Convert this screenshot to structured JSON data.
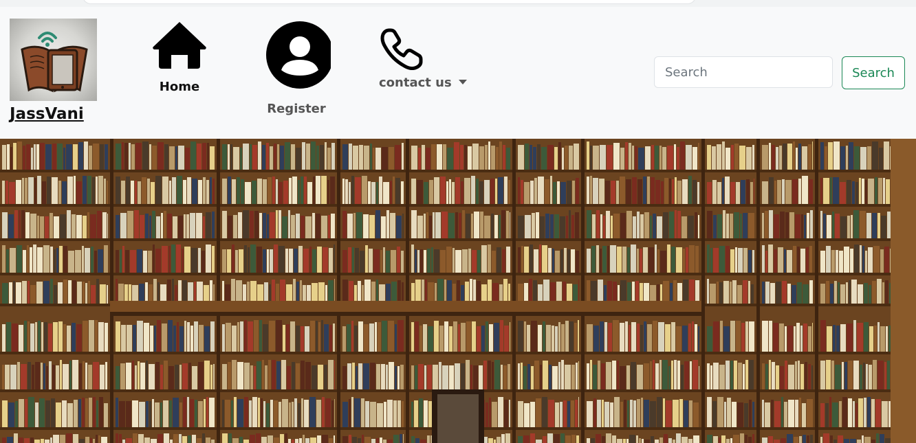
{
  "navbar": {
    "brand": {
      "name": "JassVani",
      "logo_icon": "open-book-wifi-logo"
    },
    "items": [
      {
        "label": "Home",
        "icon": "home-icon"
      },
      {
        "label": "Register",
        "icon": "account-circle-icon"
      },
      {
        "label": "contact us",
        "icon": "phone-icon",
        "dropdown": true
      }
    ],
    "search": {
      "placeholder": "Search",
      "value": "",
      "button_label": "Search"
    }
  },
  "hero": {
    "image": "library-bookshelves-photo"
  },
  "colors": {
    "navbar_bg": "#f8f9fa",
    "search_button": "#198754",
    "nav_text_dark": "#111111",
    "nav_text_muted": "#555555"
  }
}
